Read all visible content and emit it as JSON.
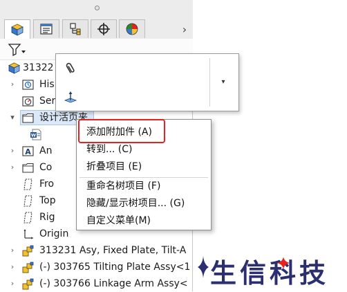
{
  "tabs": [
    {
      "name": "feature-manager"
    },
    {
      "name": "property-manager"
    },
    {
      "name": "configuration-manager"
    },
    {
      "name": "dimxpert-manager"
    },
    {
      "name": "display-manager"
    }
  ],
  "tree": {
    "root_label": "31322",
    "items": [
      {
        "label": "His",
        "expander": "›",
        "icon": "history-icon"
      },
      {
        "label": "Ser",
        "expander": "",
        "icon": "sensors-icon"
      },
      {
        "label": "设计活页夹",
        "expander": "▾",
        "icon": "design-binder-icon"
      },
      {
        "label": "",
        "expander": "",
        "icon": "word-document-icon"
      },
      {
        "label": "An",
        "expander": "›",
        "icon": "annotations-icon"
      },
      {
        "label": "Co",
        "expander": "›",
        "icon": "folder-icon"
      },
      {
        "label": "Fro",
        "expander": "",
        "icon": "plane-icon"
      },
      {
        "label": "Top",
        "expander": "",
        "icon": "plane-icon"
      },
      {
        "label": "Rig",
        "expander": "",
        "icon": "plane-icon"
      },
      {
        "label": "Origin",
        "expander": "",
        "icon": "origin-icon"
      },
      {
        "label": "313231 Asy, Fixed Plate, Tilt-A",
        "expander": "›",
        "icon": "assembly-icon"
      },
      {
        "label": "(-) 303765 Tilting Plate Assy<1",
        "expander": "›",
        "icon": "assembly-icon"
      },
      {
        "label": "(-) 303766 Linkage Arm Assy<",
        "expander": "›",
        "icon": "assembly-icon"
      }
    ]
  },
  "shortcut_bar": {
    "buttons": [
      {
        "name": "attachment-icon"
      },
      {
        "name": "normal-to-icon"
      }
    ],
    "dropdown_glyph": "▾"
  },
  "context_menu": {
    "items": [
      {
        "label": "添加附加件 (A)",
        "highlighted": true
      },
      {
        "label": "转到... (C)"
      },
      {
        "label": "折叠项目 (E)"
      },
      {
        "label": "重命名树项目 (F)"
      },
      {
        "label": "隐藏/显示树项目... (G)"
      },
      {
        "label": "自定义菜单(M)"
      }
    ]
  },
  "colors": {
    "highlight_red": "#e8201e",
    "selection_blue": "#dbe8f8",
    "watermark_navy": "#2c2f6f",
    "watermark_accent": "#e8201e"
  },
  "watermark": {
    "text": "生信科技"
  }
}
